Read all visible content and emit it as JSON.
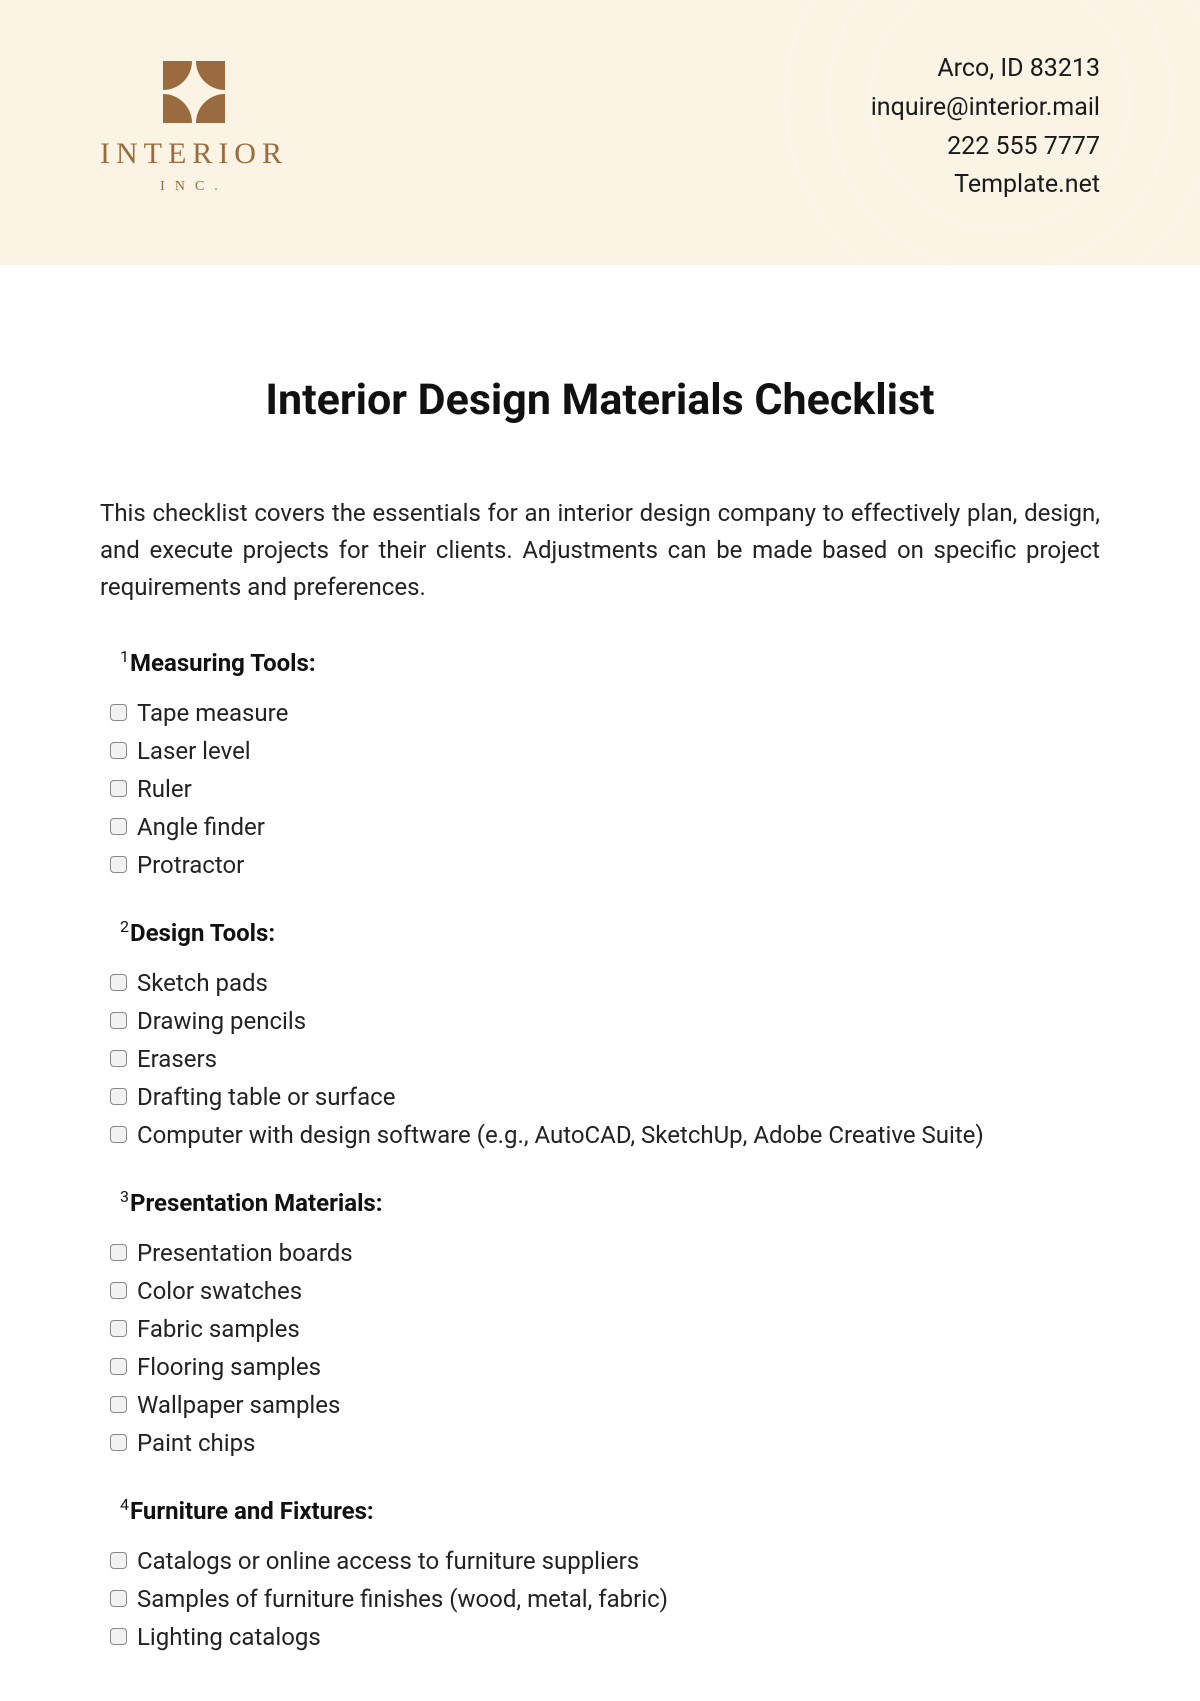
{
  "header": {
    "logo_name": "INTERIOR",
    "logo_sub": "INC.",
    "contact": {
      "address": "Arco, ID 83213",
      "email": "inquire@interior.mail",
      "phone": "222 555 7777",
      "site": "Template.net"
    }
  },
  "title": "Interior Design Materials Checklist",
  "intro": "This checklist covers the essentials for an interior design company to effectively plan, design, and execute projects for their clients. Adjustments can be made based on specific project requirements and preferences.",
  "sections": [
    {
      "num": "1",
      "title": "Measuring Tools:",
      "items": [
        "Tape measure",
        "Laser level",
        "Ruler",
        "Angle finder",
        "Protractor"
      ]
    },
    {
      "num": "2",
      "title": "Design Tools:",
      "items": [
        "Sketch pads",
        "Drawing pencils",
        "Erasers",
        "Drafting table or surface",
        "Computer with design software (e.g., AutoCAD, SketchUp, Adobe Creative Suite)"
      ]
    },
    {
      "num": "3",
      "title": "Presentation Materials:",
      "items": [
        "Presentation boards",
        "Color swatches",
        "Fabric samples",
        "Flooring samples",
        "Wallpaper samples",
        "Paint chips"
      ]
    },
    {
      "num": "4",
      "title": "Furniture and Fixtures:",
      "items": [
        "Catalogs or online access to furniture suppliers",
        "Samples of furniture finishes (wood, metal, fabric)",
        "Lighting catalogs"
      ]
    }
  ]
}
